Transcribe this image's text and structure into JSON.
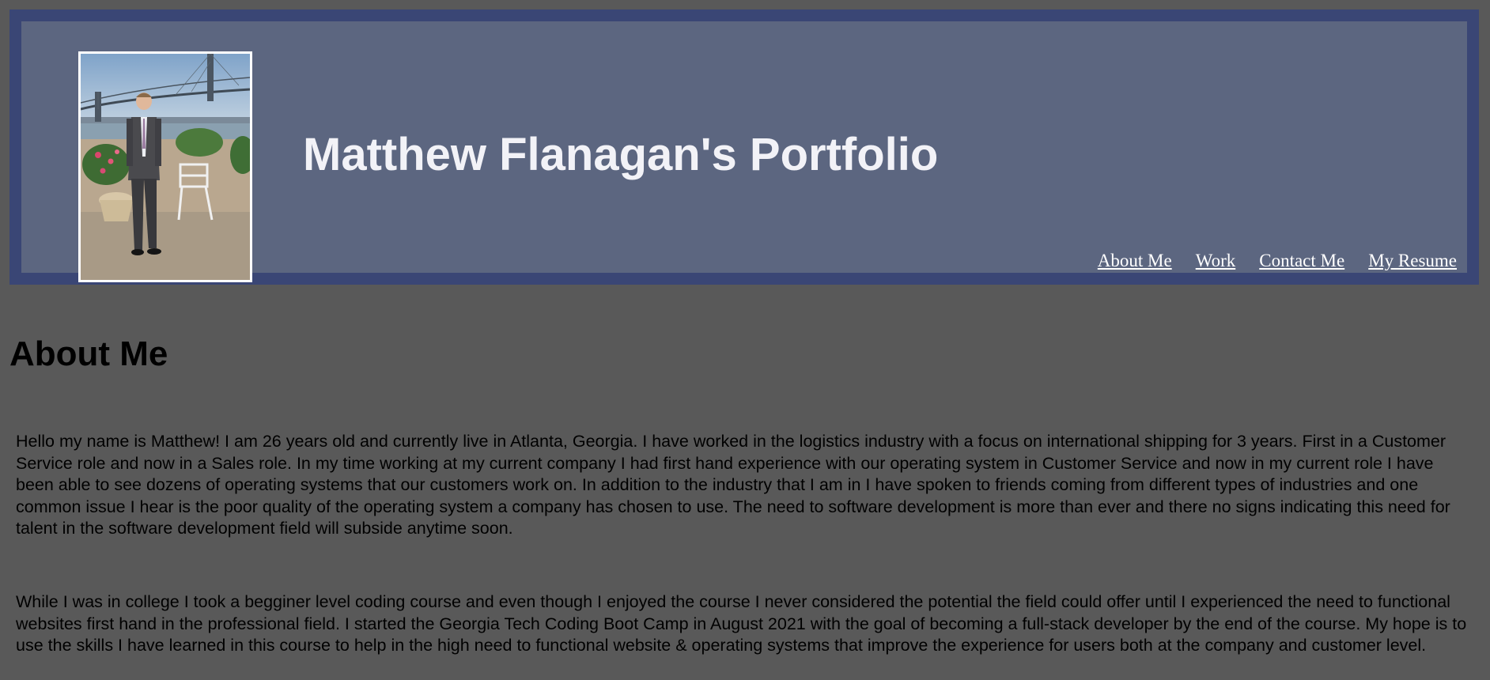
{
  "header": {
    "title": "Matthew Flanagan's Portfolio",
    "photo_icon": "profile-photo",
    "nav": [
      {
        "label": "About Me"
      },
      {
        "label": "Work"
      },
      {
        "label": "Contact Me"
      },
      {
        "label": "My Resume"
      }
    ]
  },
  "about": {
    "heading": "About Me",
    "paragraphs": [
      "Hello my name is Matthew! I am 26 years old and currently live in Atlanta, Georgia. I have worked in the logistics industry with a focus on international shipping for 3 years. First in a Customer Service role and now in a Sales role. In my time working at my current company I had first hand experience with our operating system in Customer Service and now in my current role I have been able to see dozens of operating systems that our customers work on. In addition to the industry that I am in I have spoken to friends coming from different types of industries and one common issue I hear is the poor quality of the operating system a company has chosen to use. The need to software development is more than ever and there no signs indicating this need for talent in the software development field will subside anytime soon.",
      "While I was in college I took a begginer level coding course and even though I enjoyed the course I never considered the potential the field could offer until I experienced the need to functional websites first hand in the professional field. I started the Georgia Tech Coding Boot Camp in August 2021 with the goal of becoming a full-stack developer by the end of the course. My hope is to use the skills I have learned in this course to help in the high need to functional website & operating systems that improve the experience for users both at the company and customer level."
    ]
  },
  "colors": {
    "page_background": "#595959",
    "header_background": "#5c6680",
    "header_border": "#3a4675",
    "title_text": "#f2f2f7"
  }
}
